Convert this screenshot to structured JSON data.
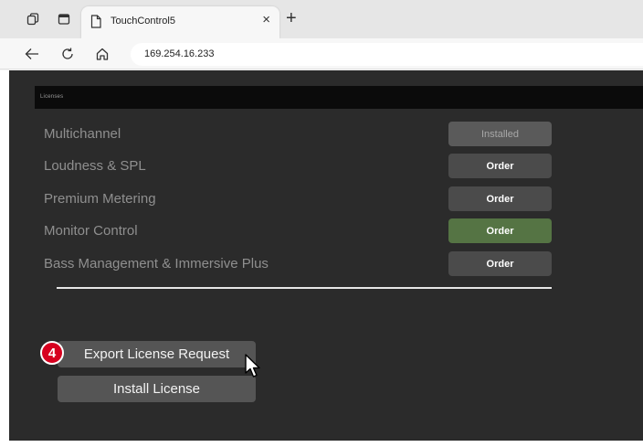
{
  "browser": {
    "tab_title": "TouchControl5",
    "tab_close": "×",
    "new_tab": "+",
    "url": "169.254.16.233"
  },
  "page": {
    "section_title": "Licenses",
    "licenses": [
      {
        "name": "Multichannel",
        "button": "Installed",
        "state": "installed"
      },
      {
        "name": "Loudness & SPL",
        "button": "Order",
        "state": "order"
      },
      {
        "name": "Premium Metering",
        "button": "Order",
        "state": "order"
      },
      {
        "name": "Monitor Control",
        "button": "Order",
        "state": "highlighted"
      },
      {
        "name": "Bass Management & Immersive Plus",
        "button": "Order",
        "state": "order"
      }
    ],
    "export_button": "Export License Request",
    "install_button": "Install License",
    "step_badge": "4"
  },
  "colors": {
    "app_background": "#2b2b2b",
    "header_background": "#0b0b0b",
    "order_button": "#4b4b4b",
    "highlighted_button": "#557444",
    "badge": "#d7001f"
  },
  "icons": [
    "workspaces-icon",
    "tab-actions-icon",
    "document-icon",
    "back-icon",
    "refresh-icon",
    "home-icon",
    "mouse-pointer-icon"
  ]
}
